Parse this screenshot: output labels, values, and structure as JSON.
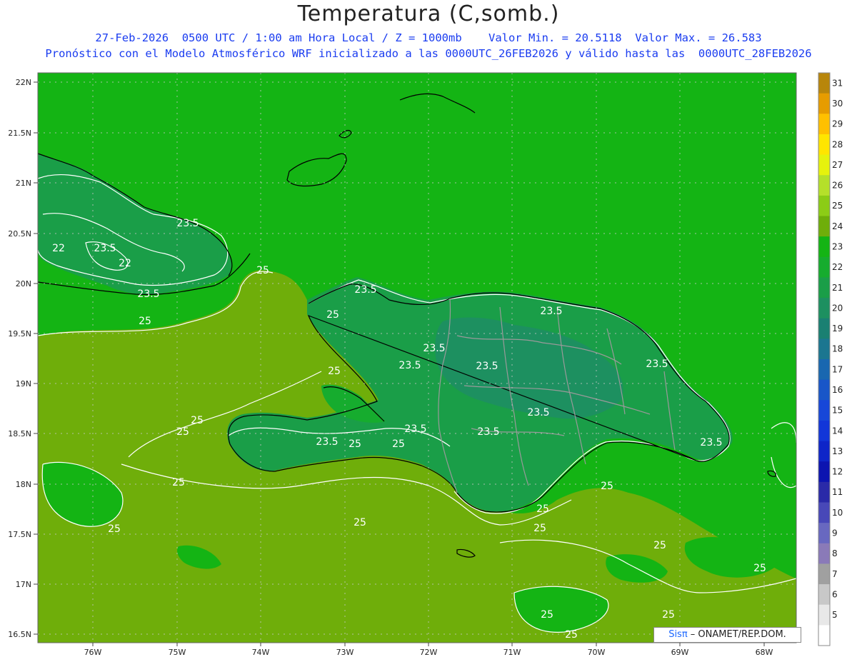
{
  "title": "Temperatura (C,somb.)",
  "subtitle_line1": "27-Feb-2026  0500 UTC / 1:00 am Hora Local / Z = 1000mb    Valor Min. = 20.5118  Valor Max. = 26.583",
  "subtitle_line2": "Pronóstico con el Modelo Atmosférico WRF inicializado a las 0000UTC_26FEB2026 y válido hasta las  0000UTC_28FEB2026",
  "credit": {
    "brand": "Sisπ",
    "text": " – ONAMET/REP.DOM."
  },
  "lat_labels": [
    "22N",
    "21.5N",
    "21N",
    "20.5N",
    "20N",
    "19.5N",
    "19N",
    "18.5N",
    "18N",
    "17.5N",
    "17N",
    "16.5N"
  ],
  "lon_labels": [
    "76W",
    "75W",
    "74W",
    "73W",
    "72W",
    "71W",
    "70W",
    "69W",
    "68W"
  ],
  "colorbar": {
    "labels": [
      "31",
      "30",
      "29",
      "28",
      "27",
      "26",
      "25",
      "24",
      "23",
      "22",
      "21",
      "20",
      "19",
      "18",
      "17",
      "16",
      "15",
      "14",
      "13",
      "12",
      "11",
      "10",
      "9",
      "8",
      "7",
      "6",
      "5"
    ],
    "colors": [
      "#b8860b",
      "#e69c00",
      "#ffc000",
      "#ffe500",
      "#e6f20d",
      "#b5e02a",
      "#8ccc16",
      "#6fae0a",
      "#14b414",
      "#16ac2e",
      "#1a9e48",
      "#1d9060",
      "#1a8072",
      "#1b7690",
      "#1967b0",
      "#1956c8",
      "#1747d8",
      "#1236d8",
      "#0e25c8",
      "#0c14b0",
      "#2a2aa8",
      "#4848b8",
      "#6868c0",
      "#8a7ab8",
      "#a0a0a0",
      "#c8c8c8",
      "#e8e8e8",
      "#ffffff"
    ]
  },
  "contour_labels": [
    {
      "text": "23.5"
    },
    {
      "text": "23.5"
    },
    {
      "text": "22"
    },
    {
      "text": "22"
    },
    {
      "text": "23.5"
    },
    {
      "text": "25"
    },
    {
      "text": "25"
    },
    {
      "text": "23.5"
    },
    {
      "text": "25"
    },
    {
      "text": "23.5"
    },
    {
      "text": "23.5"
    },
    {
      "text": "23.5"
    },
    {
      "text": "25"
    },
    {
      "text": "23.5"
    },
    {
      "text": "23.5"
    },
    {
      "text": "25"
    },
    {
      "text": "23.5"
    },
    {
      "text": "25"
    },
    {
      "text": "23.5"
    },
    {
      "text": "25"
    },
    {
      "text": "23.5"
    },
    {
      "text": "23.5"
    },
    {
      "text": "25"
    },
    {
      "text": "25"
    },
    {
      "text": "25"
    },
    {
      "text": "25"
    },
    {
      "text": "25"
    },
    {
      "text": "25"
    },
    {
      "text": "25"
    },
    {
      "text": "25"
    },
    {
      "text": "25"
    },
    {
      "text": "23.5"
    }
  ]
}
